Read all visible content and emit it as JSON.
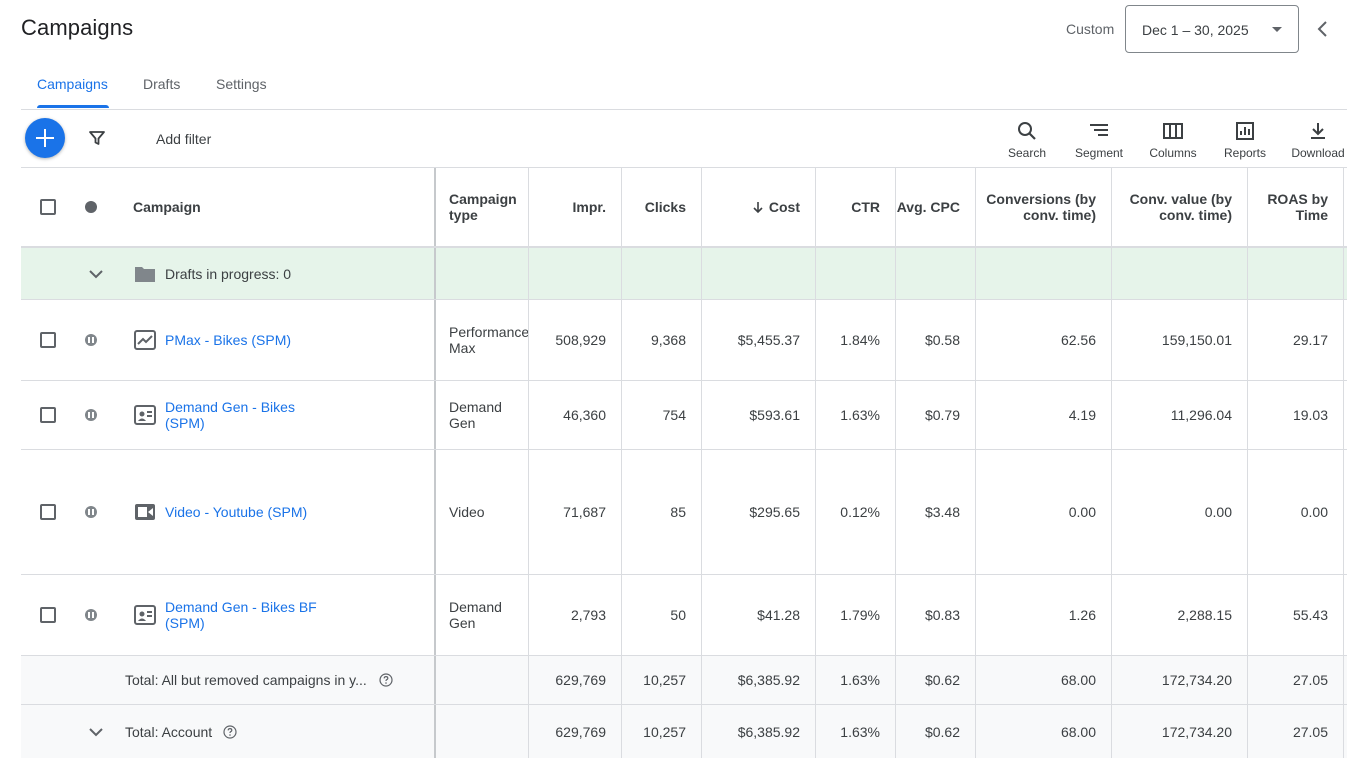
{
  "page": {
    "title": "Campaigns"
  },
  "date_range": {
    "label": "Custom",
    "value": "Dec 1 – 30, 2025"
  },
  "tabs": [
    {
      "label": "Campaigns",
      "active": true
    },
    {
      "label": "Drafts",
      "active": false
    },
    {
      "label": "Settings",
      "active": false
    }
  ],
  "toolbar": {
    "add_filter": "Add filter",
    "tools": [
      {
        "label": "Search",
        "icon": "search-icon"
      },
      {
        "label": "Segment",
        "icon": "segment-icon"
      },
      {
        "label": "Columns",
        "icon": "columns-icon"
      },
      {
        "label": "Reports",
        "icon": "reports-icon"
      },
      {
        "label": "Download",
        "icon": "download-icon"
      }
    ]
  },
  "table": {
    "headers": {
      "campaign": "Campaign",
      "type": "Campaign type",
      "impr": "Impr.",
      "clicks": "Clicks",
      "cost": "Cost",
      "ctr": "CTR",
      "avg_cpc": "Avg. CPC",
      "conversions": "Conversions (by conv. time)",
      "conv_value": "Conv. value (by conv. time)",
      "roas": "ROAS by Time"
    },
    "drafts": "Drafts in progress: 0",
    "rows": [
      {
        "campaign": "PMax - Bikes (SPM)",
        "type": "Performance Max",
        "icon": "performance-max-icon",
        "impr": "508,929",
        "clicks": "9,368",
        "cost": "$5,455.37",
        "ctr": "1.84%",
        "avg_cpc": "$0.58",
        "conversions": "62.56",
        "conv_value": "159,150.01",
        "roas": "29.17"
      },
      {
        "campaign": "Demand Gen - Bikes (SPM)",
        "type": "Demand Gen",
        "icon": "demand-gen-icon",
        "impr": "46,360",
        "clicks": "754",
        "cost": "$593.61",
        "ctr": "1.63%",
        "avg_cpc": "$0.79",
        "conversions": "4.19",
        "conv_value": "11,296.04",
        "roas": "19.03"
      },
      {
        "campaign": "Video - Youtube (SPM)",
        "type": "Video",
        "icon": "video-icon",
        "impr": "71,687",
        "clicks": "85",
        "cost": "$295.65",
        "ctr": "0.12%",
        "avg_cpc": "$3.48",
        "conversions": "0.00",
        "conv_value": "0.00",
        "roas": "0.00"
      },
      {
        "campaign": "Demand Gen - Bikes BF (SPM)",
        "type": "Demand Gen",
        "icon": "demand-gen-icon",
        "impr": "2,793",
        "clicks": "50",
        "cost": "$41.28",
        "ctr": "1.79%",
        "avg_cpc": "$0.83",
        "conversions": "1.26",
        "conv_value": "2,288.15",
        "roas": "55.43"
      }
    ],
    "totals": [
      {
        "label": "Total: All but removed campaigns in y...",
        "impr": "629,769",
        "clicks": "10,257",
        "cost": "$6,385.92",
        "ctr": "1.63%",
        "avg_cpc": "$0.62",
        "conversions": "68.00",
        "conv_value": "172,734.20",
        "roas": "27.05"
      },
      {
        "label": "Total: Account",
        "impr": "629,769",
        "clicks": "10,257",
        "cost": "$6,385.92",
        "ctr": "1.63%",
        "avg_cpc": "$0.62",
        "conversions": "68.00",
        "conv_value": "172,734.20",
        "roas": "27.05"
      }
    ]
  },
  "colors": {
    "accent": "#1a73e8",
    "drafts_bg": "#e6f4ea",
    "total_bg": "#f8f9fa"
  }
}
